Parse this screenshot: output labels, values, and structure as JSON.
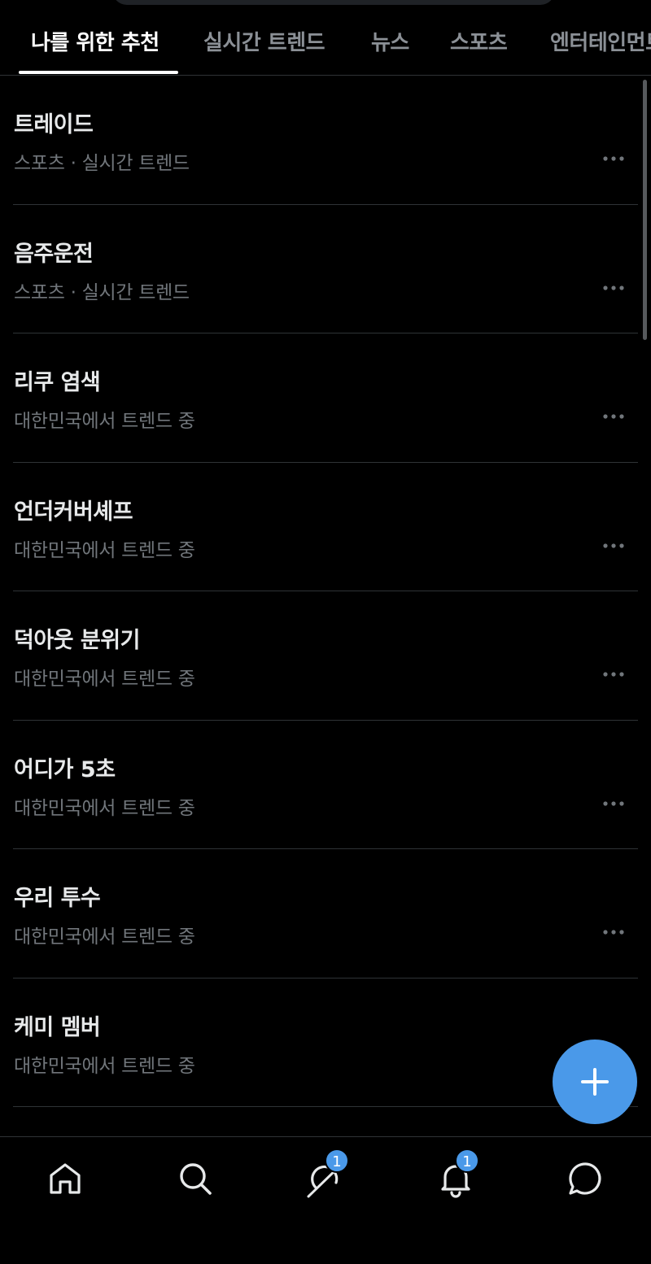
{
  "tabs": [
    {
      "label": "나를 위한 추천",
      "active": true
    },
    {
      "label": "실시간 트렌드",
      "active": false
    },
    {
      "label": "뉴스",
      "active": false
    },
    {
      "label": "스포츠",
      "active": false
    },
    {
      "label": "엔터테인먼트",
      "active": false
    }
  ],
  "trends": [
    {
      "title": "트레이드",
      "meta": "스포츠 · 실시간 트렌드"
    },
    {
      "title": "음주운전",
      "meta": "스포츠 · 실시간 트렌드"
    },
    {
      "title": "리쿠 염색",
      "meta": "대한민국에서 트렌드 중"
    },
    {
      "title": "언더커버셰프",
      "meta": "대한민국에서 트렌드 중"
    },
    {
      "title": "덕아웃 분위기",
      "meta": "대한민국에서 트렌드 중"
    },
    {
      "title": "어디가 5초",
      "meta": "대한민국에서 트렌드 중"
    },
    {
      "title": "우리 투수",
      "meta": "대한민국에서 트렌드 중"
    },
    {
      "title": "케미 멤버",
      "meta": "대한민국에서 트렌드 중"
    }
  ],
  "partial_trend_title": "",
  "nav": {
    "items": [
      {
        "icon": "home-icon"
      },
      {
        "icon": "search-icon"
      },
      {
        "icon": "grok-icon",
        "badge": "1"
      },
      {
        "icon": "bell-icon",
        "badge": "1"
      },
      {
        "icon": "messages-icon"
      }
    ]
  },
  "fab": {
    "icon": "plus-icon"
  },
  "colors": {
    "background": "#000000",
    "accent": "#4a99e9",
    "text_primary": "#e7e9ea",
    "text_secondary": "#71767b",
    "divider": "#2f3336"
  }
}
